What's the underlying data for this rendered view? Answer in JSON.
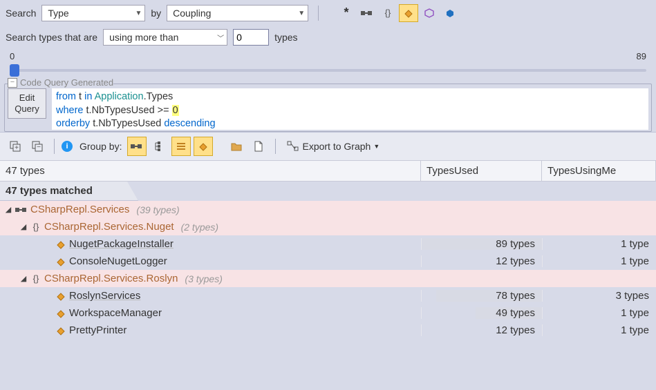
{
  "search": {
    "label": "Search",
    "scope": "Type",
    "by_label": "by",
    "metric": "Coupling"
  },
  "filter": {
    "prefix": "Search types that are",
    "predicate": "using more than",
    "value": "0",
    "suffix": "types"
  },
  "slider": {
    "min": "0",
    "max": "89"
  },
  "query": {
    "legend": "Code Query Generated",
    "edit_label": "Edit\nQuery",
    "line1_kw1": "from",
    "line1_var": " t ",
    "line1_kw2": "in",
    "line1_obj": " Application",
    "line1_dot": ".Types",
    "line2_kw": "where",
    "line2_rest": " t.NbTypesUsed >= ",
    "line2_num": "0",
    "line3_kw1": "orderby",
    "line3_rest": " t.NbTypesUsed ",
    "line3_kw2": "descending"
  },
  "toolbar": {
    "group_by": "Group by:",
    "export": "Export to Graph"
  },
  "table": {
    "summary": "47 types",
    "col_used": "TypesUsed",
    "col_using": "TypesUsingMe",
    "matched": "47 types matched"
  },
  "tree": {
    "root": {
      "name": "CSharpRepl.Services",
      "count": "(39 types)"
    },
    "ns1": {
      "name": "CSharpRepl.Services.Nuget",
      "count": "(2 types)"
    },
    "ns1_items": [
      {
        "name": "NugetPackageInstaller",
        "used": "89 types",
        "using": "1 type",
        "bar": 100
      },
      {
        "name": "ConsoleNugetLogger",
        "used": "12 types",
        "using": "1 type",
        "bar": 0
      }
    ],
    "ns2": {
      "name": "CSharpRepl.Services.Roslyn",
      "count": "(3 types)"
    },
    "ns2_items": [
      {
        "name": "RoslynServices",
        "used": "78 types",
        "using": "3 types",
        "bar": 88
      },
      {
        "name": "WorkspaceManager",
        "used": "49 types",
        "using": "1 type",
        "bar": 55
      },
      {
        "name": "PrettyPrinter",
        "used": "12 types",
        "using": "1 type",
        "bar": 0
      }
    ]
  }
}
